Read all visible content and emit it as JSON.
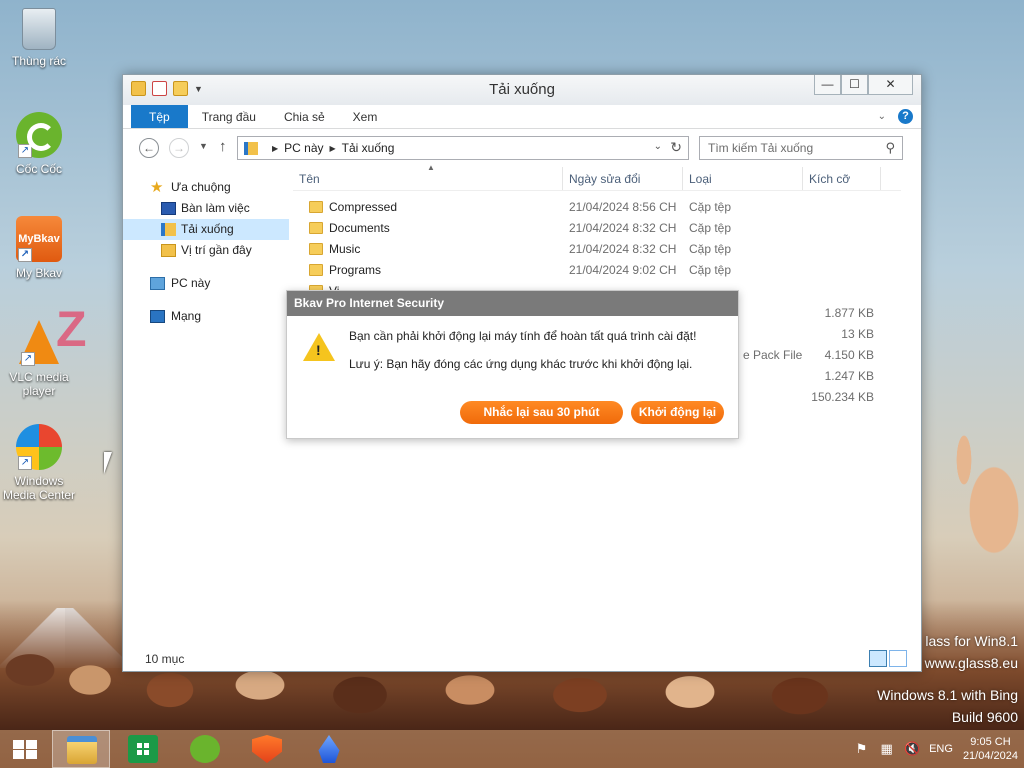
{
  "desktop": {
    "icons": [
      {
        "label": "Thùng rác",
        "icon": "recycle-bin-icon"
      },
      {
        "label": "Cốc Cốc",
        "icon": "coccoc-icon"
      },
      {
        "label": "My Bkav",
        "icon": "mybkav-icon"
      },
      {
        "label": "VLC media player",
        "icon": "vlc-icon"
      },
      {
        "label": "Windows Media Center",
        "icon": "windows-media-center-icon"
      }
    ],
    "mybkav_logo_text": "MyBkav",
    "watermark_lines": [
      "lass for Win8.1",
      "www.glass8.eu"
    ],
    "build_lines": [
      "Windows 8.1 with Bing",
      "Build 9600"
    ]
  },
  "window": {
    "title": "Tải xuống",
    "ribbon_tabs": [
      "Tệp",
      "Trang đầu",
      "Chia sẻ",
      "Xem"
    ],
    "address": {
      "root": "PC này",
      "current": "Tải xuống"
    },
    "search_placeholder": "Tìm kiếm Tải xuống",
    "nav": {
      "favorites": "Ưa chuộng",
      "desktop": "Bàn làm việc",
      "downloads": "Tải xuống",
      "recent": "Vị trí gần đây",
      "pc": "PC này",
      "network": "Mạng"
    },
    "columns": [
      "Tên",
      "Ngày sửa đổi",
      "Loại",
      "Kích cỡ"
    ],
    "rows": [
      {
        "name": "Compressed",
        "date": "21/04/2024 8:56 CH",
        "type": "Cặp tệp",
        "size": ""
      },
      {
        "name": "Documents",
        "date": "21/04/2024 8:32 CH",
        "type": "Cặp tệp",
        "size": ""
      },
      {
        "name": "Music",
        "date": "21/04/2024 8:32 CH",
        "type": "Cặp tệp",
        "size": ""
      },
      {
        "name": "Programs",
        "date": "21/04/2024 9:02 CH",
        "type": "Cặp tệp",
        "size": ""
      }
    ],
    "partial_row_name": "Vi",
    "partial_type": "e Pack File",
    "obscured_sizes": [
      "1.877 KB",
      "13 KB",
      "4.150 KB",
      "1.247 KB",
      "150.234 KB"
    ],
    "status": "10 mục"
  },
  "dialog": {
    "title": "Bkav Pro Internet Security",
    "message": "Bạn cần phải khởi động lại máy tính để hoàn tất quá trình cài đặt!",
    "note": "Lưu ý: Bạn hãy đóng các ứng dụng khác trước khi khởi động lại.",
    "remind_button": "Nhắc lại sau 30 phút",
    "restart_button": "Khởi động lại"
  },
  "taskbar": {
    "language": "ENG",
    "time": "9:05 CH",
    "date": "21/04/2024"
  },
  "colors": {
    "ribbon_file_tab": "#1979ca",
    "dialog_title_bg": "#7a7a7a",
    "dialog_button": "#f06a0a",
    "selected_nav": "#cce8ff"
  }
}
